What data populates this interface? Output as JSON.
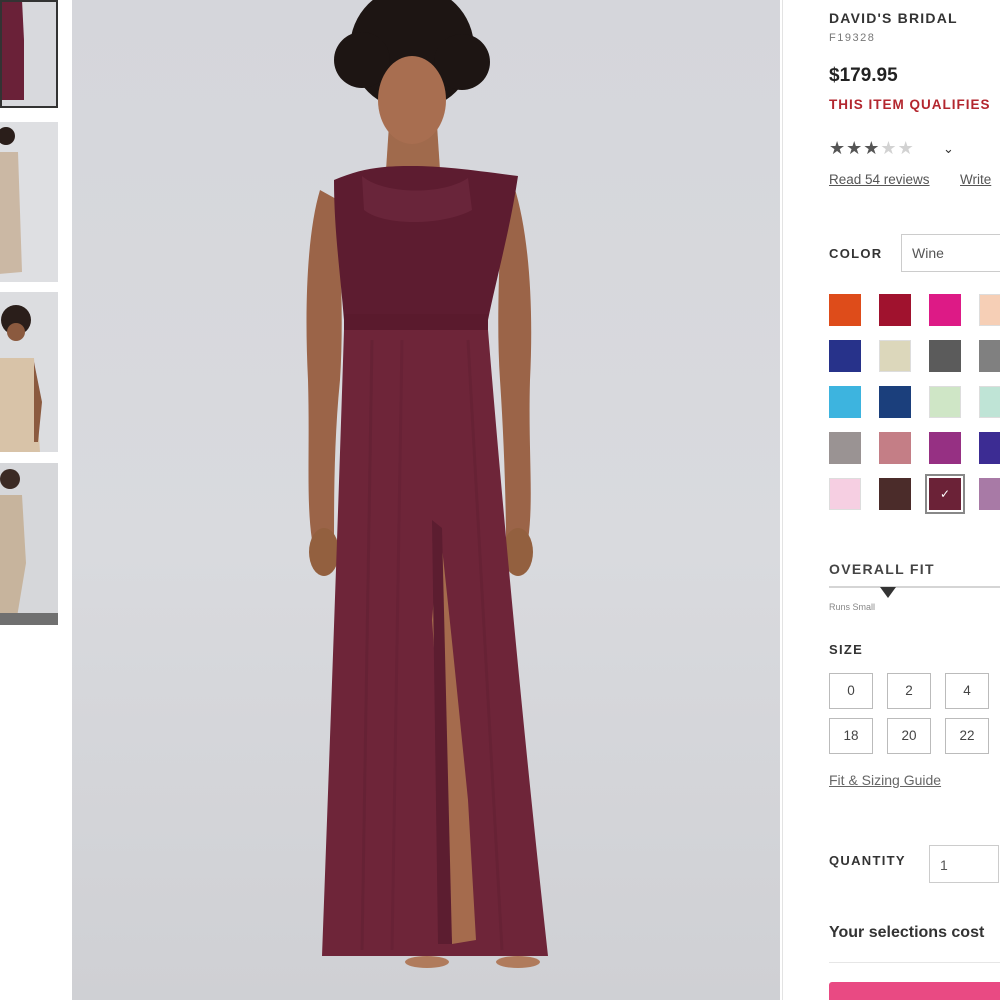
{
  "product": {
    "brand": "DAVID'S BRIDAL",
    "sku": "F19328",
    "price": "$179.95",
    "promo": "THIS ITEM QUALIFIES",
    "rating": {
      "stars_filled": 3,
      "stars_total": 5
    },
    "reviews_link": "Read 54 reviews",
    "write_review_link": "Write"
  },
  "color": {
    "label": "COLOR",
    "selected": "Wine",
    "swatches": [
      [
        "#de4c1a",
        "#a0122e",
        "#dd1a86",
        "#f6cfb6"
      ],
      [
        "#27328a",
        "#dcd7bb",
        "#5b5b5b",
        "#808080"
      ],
      [
        "#3db4df",
        "#1b3f7c",
        "#cfe6c6",
        "#bfe4d6"
      ],
      [
        "#9a9393",
        "#c47e86",
        "#963083",
        "#3c2c93"
      ],
      [
        "#f6cfe2",
        "#4b2c2a",
        "#6b2237",
        "#a87aa6"
      ]
    ],
    "selected_swatch": [
      4,
      2
    ]
  },
  "fit": {
    "label": "OVERALL FIT",
    "low_label": "Runs Small",
    "position": 0.33
  },
  "size": {
    "label": "SIZE",
    "options": [
      [
        "0",
        "2",
        "4"
      ],
      [
        "18",
        "20",
        "22"
      ]
    ],
    "guide_link": "Fit & Sizing Guide"
  },
  "quantity": {
    "label": "QUANTITY",
    "value": "1"
  },
  "selections_text": "Your selections cost",
  "icons": {
    "zoom": "heart-icon",
    "chevron": "chevron-down-icon"
  }
}
